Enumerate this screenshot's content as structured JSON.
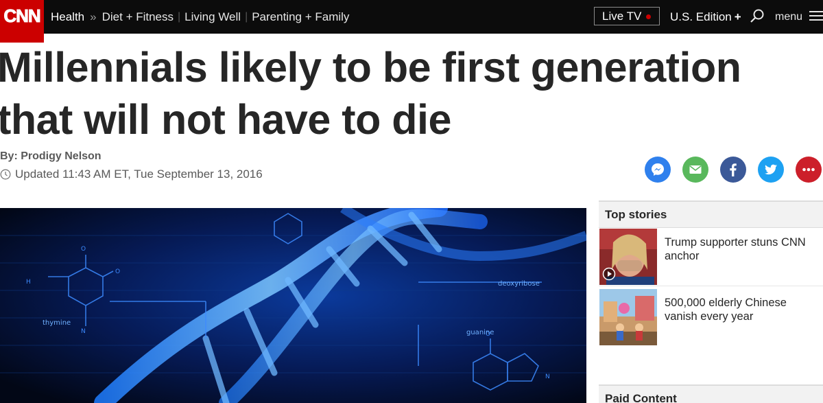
{
  "nav": {
    "logo": "CNN",
    "section": "Health",
    "separator": "»",
    "links": [
      "Diet + Fitness",
      "Living Well",
      "Parenting + Family"
    ],
    "live_tv": "Live TV",
    "edition": "U.S. Edition",
    "edition_plus": "+",
    "menu": "menu"
  },
  "article": {
    "headline": "Millennials likely to be first generation that will not have to die",
    "byline": "By: Prodigy Nelson",
    "timestamp": "Updated 11:43 AM ET, Tue September 13, 2016"
  },
  "share": [
    "messenger-icon",
    "email-icon",
    "facebook-icon",
    "twitter-icon",
    "more-icon"
  ],
  "hero": {
    "labels": {
      "deoxyribose": "deoxyribose",
      "thymine": "thymine",
      "guanine": "guanine"
    }
  },
  "rail": {
    "top_stories_title": "Top stories",
    "stories": [
      {
        "title": "Trump supporter stuns CNN anchor"
      },
      {
        "title": "500,000 elderly Chinese vanish every year"
      }
    ],
    "paid_content_title": "Paid Content"
  },
  "colors": {
    "cnn_red": "#cc0000",
    "nav_bg": "#0c0c0c",
    "messenger": "#2f80ed",
    "email": "#59b85c",
    "facebook": "#3b5998",
    "twitter": "#1da1f2",
    "more": "#cc1f2a"
  }
}
